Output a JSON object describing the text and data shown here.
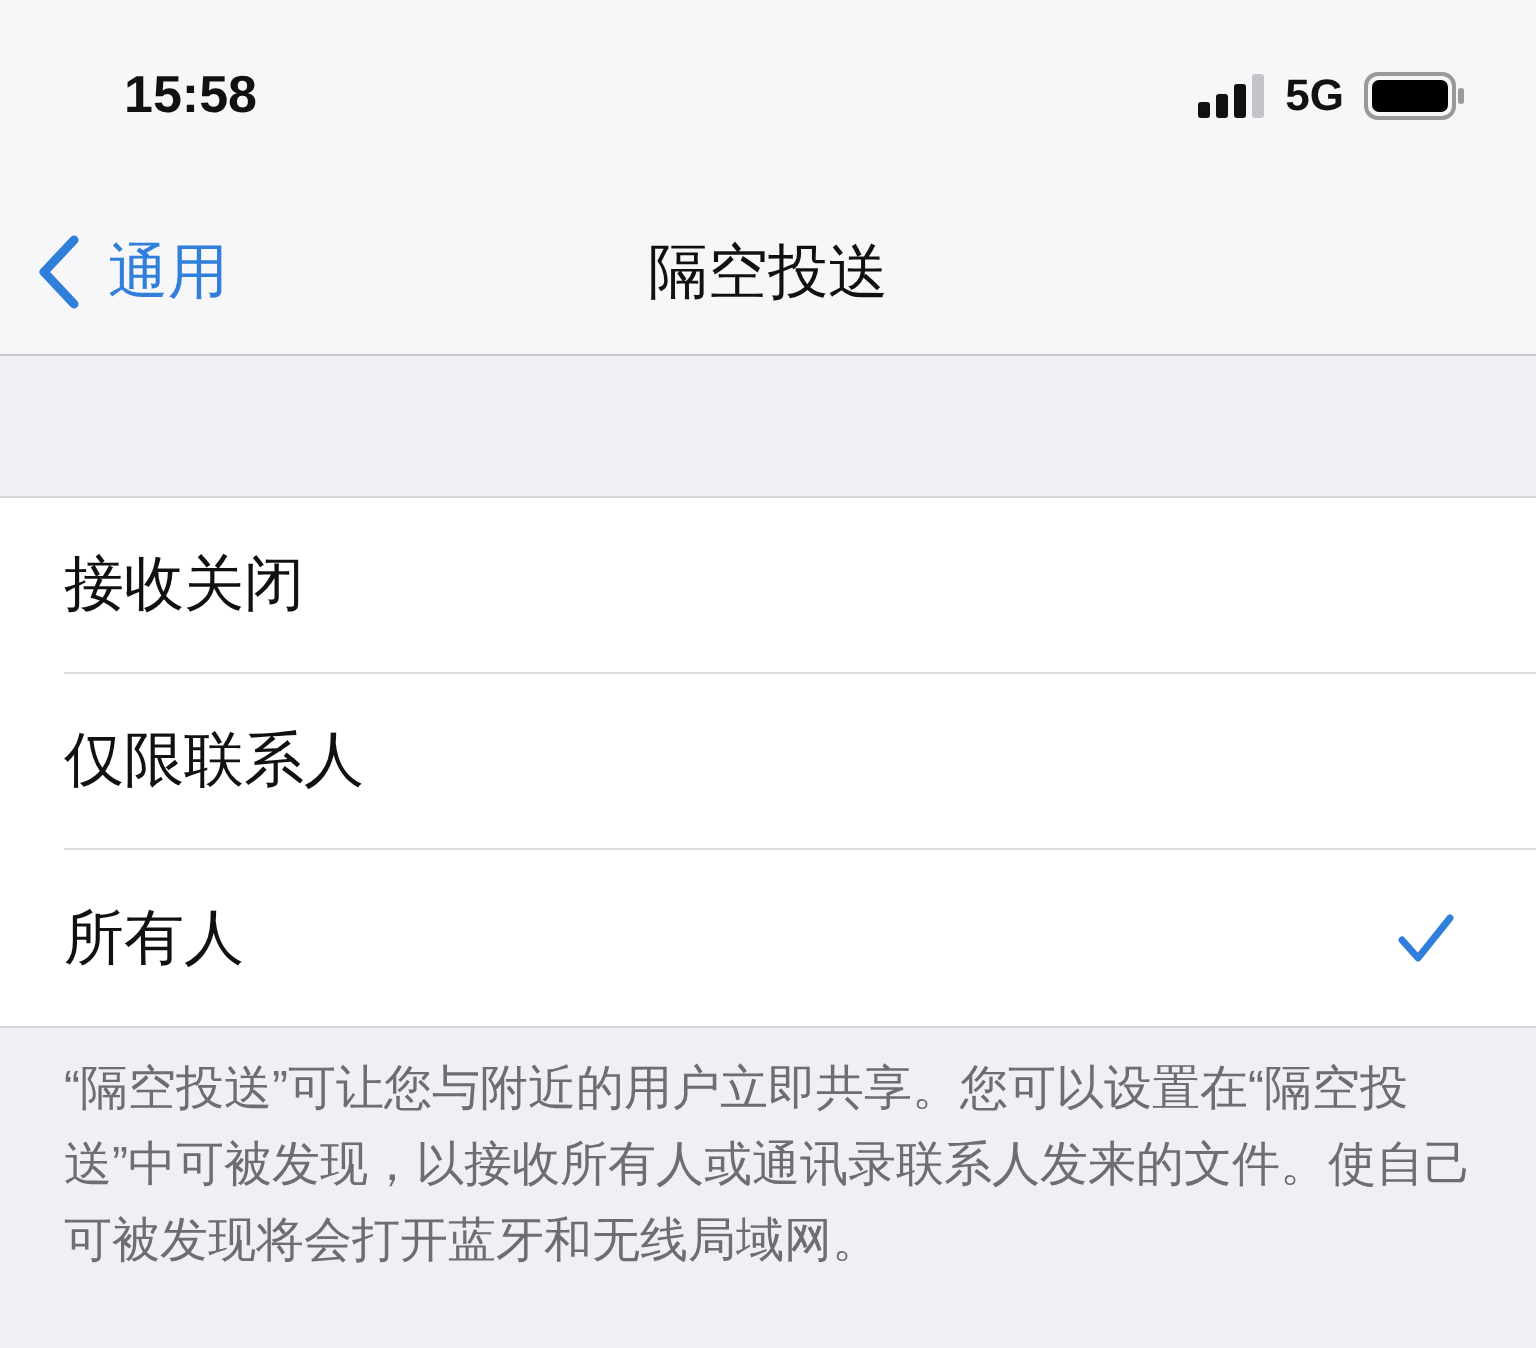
{
  "status_bar": {
    "time": "15:58",
    "network": "5G"
  },
  "nav": {
    "back_label": "通用",
    "title": "隔空投送"
  },
  "options": [
    {
      "label": "接收关闭",
      "selected": false
    },
    {
      "label": "仅限联系人",
      "selected": false
    },
    {
      "label": "所有人",
      "selected": true
    }
  ],
  "footer": "“隔空投送”可让您与附近的用户立即共享。您可以设置在“隔空投送”中可被发现，以接收所有人或通讯录联系人发来的文件。使自己可被发现将会打开蓝牙和无线局域网。"
}
